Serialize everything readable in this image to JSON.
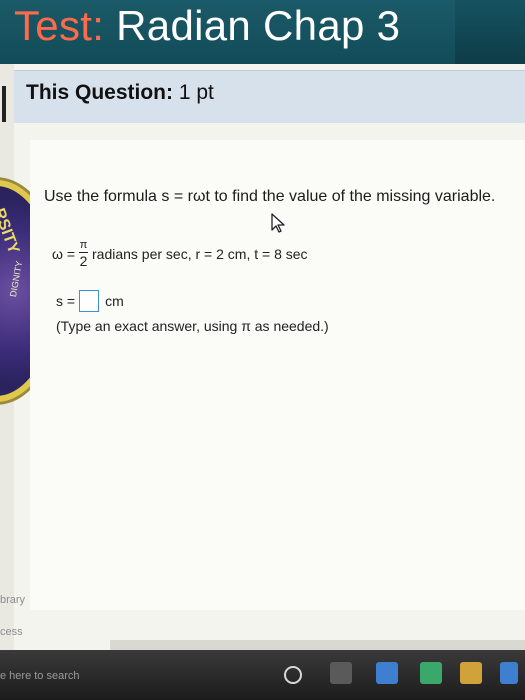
{
  "header": {
    "title_prefix": "Test:",
    "title_rest": " Radian Chap 3"
  },
  "question_header": {
    "label": "This Question:",
    "points": "1 pt"
  },
  "question": {
    "prompt": "Use the formula s = rωt to find the value of the missing variable.",
    "omega_label": "ω =",
    "omega_numerator": "π",
    "omega_denominator": "2",
    "given_rest": "radians per sec, r = 2 cm, t = 8 sec",
    "answer_prefix": "s =",
    "answer_value": "",
    "answer_unit": "cm",
    "hint": "(Type an exact answer, using π as needed.)"
  },
  "seal": {
    "text_top": "RSITY",
    "text_side": "DIGNITY"
  },
  "sidebar": {
    "library": "brary",
    "access": "cess"
  },
  "taskbar": {
    "search_placeholder": "e here to search"
  },
  "colors": {
    "topbar": "#1b5a68",
    "title_accent": "#ff6b4a",
    "question_header_bg": "#d7e1ec",
    "answer_box_border": "#3f8fd8"
  }
}
